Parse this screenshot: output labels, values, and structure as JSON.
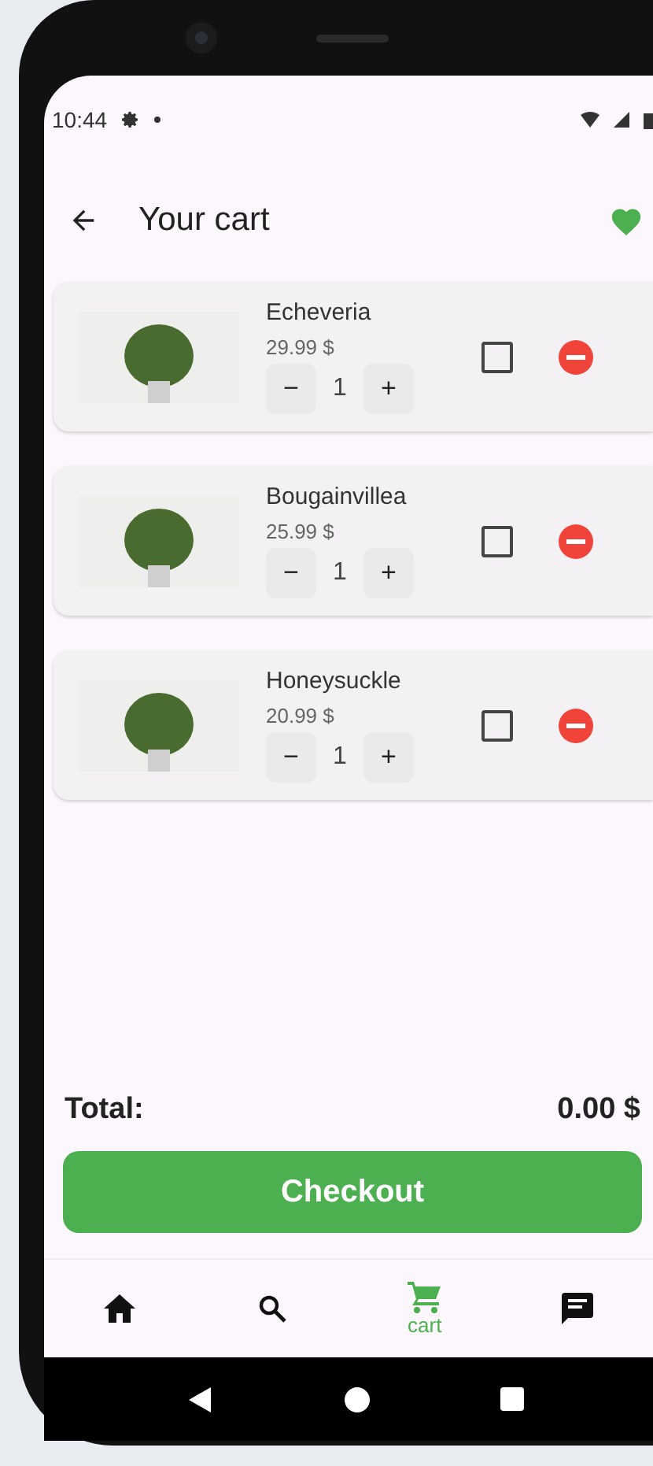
{
  "status_bar": {
    "time": "10:44"
  },
  "header": {
    "title": "Your cart"
  },
  "items": [
    {
      "name": "Echeveria",
      "price": "29.99 $",
      "quantity": "1",
      "minus": "−",
      "plus": "+",
      "checked": false
    },
    {
      "name": "Bougainvillea",
      "price": "25.99 $",
      "quantity": "1",
      "minus": "−",
      "plus": "+",
      "checked": false
    },
    {
      "name": "Honeysuckle",
      "price": "20.99 $",
      "quantity": "1",
      "minus": "−",
      "plus": "+",
      "checked": false
    }
  ],
  "total": {
    "label": "Total:",
    "value": "0.00 $"
  },
  "checkout_button": "Checkout",
  "bottom_nav": [
    {
      "kind": "home",
      "selected": false
    },
    {
      "kind": "search",
      "selected": false
    },
    {
      "kind": "cart",
      "label": "cart",
      "selected": true
    },
    {
      "kind": "chat",
      "selected": false
    }
  ]
}
